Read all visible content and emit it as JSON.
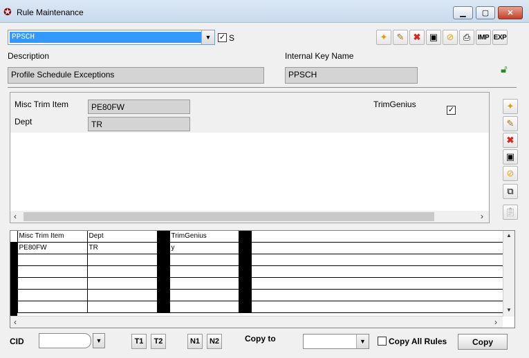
{
  "window": {
    "title": "Rule Maintenance",
    "min": "▁",
    "max": "▢",
    "close": "✕"
  },
  "rule_select": {
    "value": "PPSCH"
  },
  "s_checkbox": {
    "label": "S",
    "checked": "✓"
  },
  "toolbar": {
    "imp": "IMP",
    "exp": "EXP"
  },
  "description": {
    "label": "Description",
    "value": "Profile Schedule Exceptions"
  },
  "internal_key": {
    "label": "Internal Key Name",
    "value": "PPSCH"
  },
  "detail": {
    "misc_trim_label": "Misc Trim Item",
    "misc_trim_value": "PE80FW",
    "dept_label": "Dept",
    "dept_value": "TR",
    "trimgenius_label": "TrimGenius",
    "trimgenius_checked": "✓"
  },
  "grid": {
    "headers": [
      "Misc Trim Item",
      "Dept",
      "TrimGenius"
    ],
    "rows": [
      [
        "PE80FW",
        "TR",
        "y"
      ]
    ]
  },
  "bottom": {
    "cid_label": "CID",
    "t1": "T1",
    "t2": "T2",
    "n1": "N1",
    "n2": "N2",
    "copy_to_label": "Copy to",
    "copy_all_label": "Copy All Rules",
    "copy_button": "Copy"
  },
  "icons": {
    "new": "new-icon",
    "edit": "edit-icon",
    "delete": "delete-icon",
    "save": "save-icon",
    "cancel": "cancel-icon",
    "print": "print-icon",
    "unlock": "unlock-icon",
    "copy": "copy-icon",
    "paste": "paste-icon"
  },
  "colors": {
    "selection": "#3399ff",
    "delete": "#d9261c",
    "cancel": "#f0a020",
    "unlock": "#2a8a2a"
  }
}
